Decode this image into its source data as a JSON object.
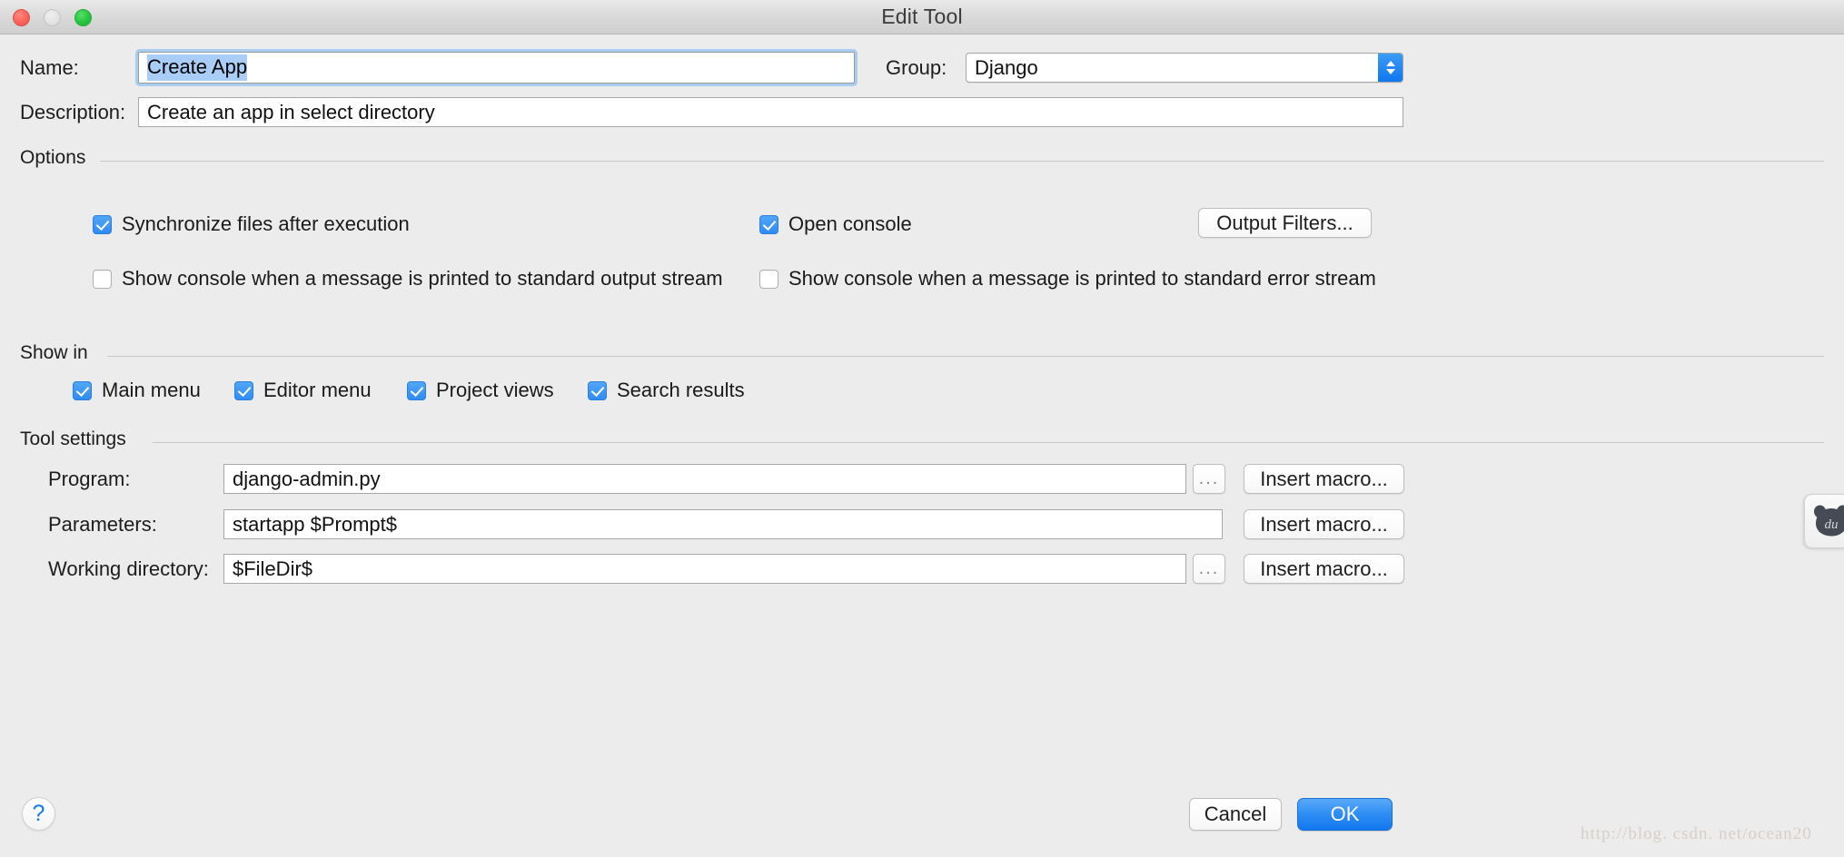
{
  "window": {
    "title": "Edit Tool",
    "traffic_lights": [
      "close",
      "minimize",
      "zoom"
    ]
  },
  "form": {
    "name_label": "Name:",
    "name_value": "Create App",
    "group_label": "Group:",
    "group_value": "Django",
    "description_label": "Description:",
    "description_value": "Create an app in select directory"
  },
  "options": {
    "section_title": "Options",
    "checkboxes": [
      {
        "label": "Synchronize files after execution",
        "checked": true
      },
      {
        "label": "Open console",
        "checked": true
      },
      {
        "label": "Show console when a message is printed to standard output stream",
        "checked": false
      },
      {
        "label": "Show console when a message is printed to standard error stream",
        "checked": false
      }
    ],
    "output_filters_label": "Output Filters..."
  },
  "show_in": {
    "section_title": "Show in",
    "checkboxes": [
      {
        "label": "Main menu",
        "checked": true
      },
      {
        "label": "Editor menu",
        "checked": true
      },
      {
        "label": "Project views",
        "checked": true
      },
      {
        "label": "Search results",
        "checked": true
      }
    ]
  },
  "tool_settings": {
    "section_title": "Tool settings",
    "rows": [
      {
        "label": "Program:",
        "value": "django-admin.py",
        "browse_label": "...",
        "macro_label": "Insert macro..."
      },
      {
        "label": "Parameters:",
        "value": "startapp $Prompt$",
        "macro_label": "Insert macro..."
      },
      {
        "label": "Working directory:",
        "value": "$FileDir$",
        "browse_label": "...",
        "macro_label": "Insert macro..."
      }
    ]
  },
  "footer": {
    "help_label": "?",
    "cancel_label": "Cancel",
    "ok_label": "OK"
  },
  "watermark": "http://blog. csdn. net/ocean20",
  "badge": {
    "text": "du"
  },
  "colors": {
    "accent_blue": "#2f8cf3",
    "window_bg": "#ececec",
    "selection_blue": "#a8cdf7"
  }
}
